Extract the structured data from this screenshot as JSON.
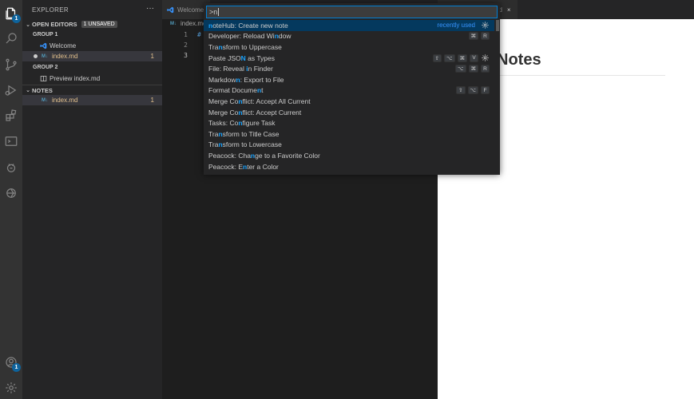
{
  "sidebar": {
    "title": "EXPLORER",
    "more": "···",
    "open_editors": {
      "label": "OPEN EDITORS",
      "badge": "1 UNSAVED"
    },
    "group1": {
      "label": "GROUP 1",
      "items": [
        {
          "label": "Welcome",
          "icon": "vscode-icon"
        },
        {
          "label": "index.md",
          "icon": "markdown-icon",
          "count": "1"
        }
      ]
    },
    "group2": {
      "label": "GROUP 2",
      "items": [
        {
          "label": "Preview index.md",
          "icon": "preview-icon"
        }
      ]
    },
    "notes": {
      "label": "NOTES",
      "items": [
        {
          "label": "index.md",
          "icon": "markdown-icon",
          "count": "1"
        }
      ]
    }
  },
  "activity": {
    "explorer_badge": "1",
    "account_badge": "1"
  },
  "editor1": {
    "tabs": [
      {
        "label": "Welcome"
      }
    ],
    "breadcrumb": "index.md",
    "lines": [
      "1",
      "2",
      "3"
    ],
    "code_line1": "#"
  },
  "editor2": {
    "tab_label": "nd",
    "tab_close": "×",
    "preview_title": "Notes"
  },
  "palette": {
    "input_value": ">n",
    "items": [
      {
        "pre": "",
        "hl": "n",
        "post": "oteHub: Create new note",
        "right_text": "recently used",
        "gear": true,
        "keys": []
      },
      {
        "pre": "Developer: Reload Wi",
        "hl": "n",
        "post": "dow",
        "keys": [
          "⌘",
          "R"
        ]
      },
      {
        "pre": "Tra",
        "hl": "n",
        "post": "sform to Uppercase",
        "keys": []
      },
      {
        "pre": "Paste JSO",
        "hl": "N",
        "post": " as Types",
        "keys": [
          "⇧",
          "⌥",
          "⌘",
          "V"
        ],
        "gear": true
      },
      {
        "pre": "File: Reveal ",
        "hl": "i",
        "post": "n Finder",
        "keys": [
          "⌥",
          "⌘",
          "R"
        ]
      },
      {
        "pre": "Markdow",
        "hl": "n",
        "post": ": Export to File",
        "keys": []
      },
      {
        "pre": "Format Docume",
        "hl": "n",
        "post": "t",
        "keys": [
          "⇧",
          "⌥",
          "F"
        ]
      },
      {
        "pre": "Merge Co",
        "hl": "n",
        "post": "flict: Accept All Current",
        "keys": []
      },
      {
        "pre": "Merge Co",
        "hl": "n",
        "post": "flict: Accept Current",
        "keys": []
      },
      {
        "pre": "Tasks: Co",
        "hl": "n",
        "post": "figure Task",
        "keys": []
      },
      {
        "pre": "Tra",
        "hl": "n",
        "post": "sform to Title Case",
        "keys": []
      },
      {
        "pre": "Tra",
        "hl": "n",
        "post": "sform to Lowercase",
        "keys": []
      },
      {
        "pre": "Peacock: Cha",
        "hl": "n",
        "post": "ge to a Favorite Color",
        "keys": []
      },
      {
        "pre": "Peacock: E",
        "hl": "n",
        "post": "ter a Color",
        "keys": []
      }
    ]
  },
  "colors": {
    "accent": "#007fd4",
    "highlight": "#18a3ff",
    "modified": "#e2c08d",
    "focus_row": "#04395e"
  }
}
